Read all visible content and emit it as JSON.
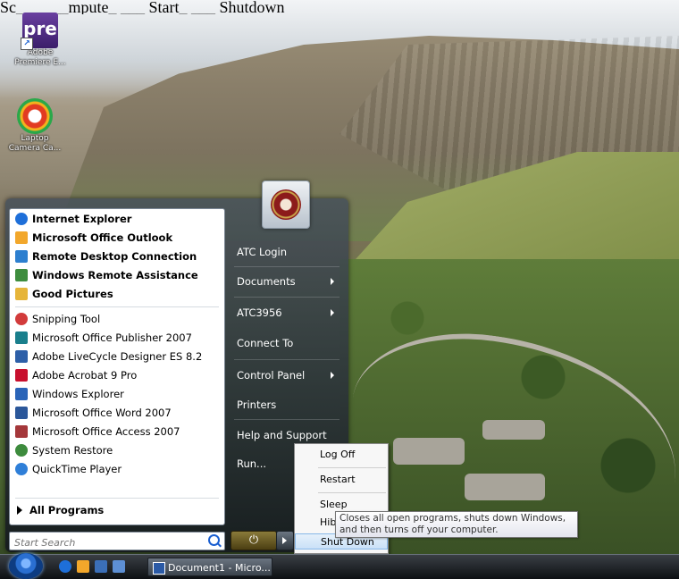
{
  "caption": "Sc___ ___mpute_ ___ Start_ ___ Shutdown",
  "desktop": {
    "icons": [
      {
        "label_line1": "Adobe",
        "label_line2": "Premiere E...",
        "glyph_text": "pre",
        "icon": "premiere-icon"
      },
      {
        "label_line1": "Laptop",
        "label_line2": "Camera Ca...",
        "icon": "camera-icon"
      }
    ]
  },
  "start_menu": {
    "pinned": [
      {
        "label": "Internet Explorer",
        "icon": "internet-explorer-icon",
        "color": "#1e6fd9"
      },
      {
        "label": "Microsoft Office Outlook",
        "icon": "outlook-icon",
        "color": "#f2a72b"
      },
      {
        "label": "Remote Desktop Connection",
        "icon": "remote-desktop-icon",
        "color": "#2d7fcf"
      },
      {
        "label": "Windows Remote Assistance",
        "icon": "remote-assistance-icon",
        "color": "#3e8d3e"
      },
      {
        "label": "Good Pictures",
        "icon": "folder-icon",
        "color": "#e6b53a"
      }
    ],
    "recent": [
      {
        "label": "Snipping Tool",
        "icon": "snipping-tool-icon",
        "color": "#d23b3b"
      },
      {
        "label": "Microsoft Office Publisher 2007",
        "icon": "publisher-icon",
        "color": "#1a7f8c"
      },
      {
        "label": "Adobe LiveCycle Designer ES 8.2",
        "icon": "livecycle-icon",
        "color": "#2d5fa8"
      },
      {
        "label": "Adobe Acrobat 9 Pro",
        "icon": "acrobat-icon",
        "color": "#c8102e"
      },
      {
        "label": "Windows Explorer",
        "icon": "explorer-icon",
        "color": "#2a64b8"
      },
      {
        "label": "Microsoft Office Word 2007",
        "icon": "word-icon",
        "color": "#2b579a"
      },
      {
        "label": "Microsoft Office Access 2007",
        "icon": "access-icon",
        "color": "#a4373a"
      },
      {
        "label": "System Restore",
        "icon": "system-restore-icon",
        "color": "#3d8b3d"
      },
      {
        "label": "QuickTime Player",
        "icon": "quicktime-icon",
        "color": "#2f7fd8"
      }
    ],
    "all_programs": "All Programs",
    "search_placeholder": "Start Search",
    "right_items": [
      {
        "label": "ATC Login",
        "has_submenu": false
      },
      {
        "label": "Documents",
        "has_submenu": true
      },
      {
        "label": "ATC3956",
        "has_submenu": true
      },
      {
        "label": "Connect To",
        "has_submenu": false
      },
      {
        "label": "Control Panel",
        "has_submenu": true
      },
      {
        "label": "Printers",
        "has_submenu": false
      },
      {
        "label": "Help and Support",
        "has_submenu": false
      },
      {
        "label": "Run...",
        "has_submenu": false
      }
    ],
    "power_symbol": "⏻"
  },
  "shutdown_menu": {
    "items": [
      "Log Off",
      "Restart",
      "Sleep",
      "Hibernate",
      "Shut Down"
    ],
    "visible_hibernate": "Hib",
    "highlighted": "Shut Down"
  },
  "tooltip": "Closes all open programs, shuts down Windows, and then turns off your computer.",
  "taskbar": {
    "window_button": "Document1 - Micro..."
  }
}
